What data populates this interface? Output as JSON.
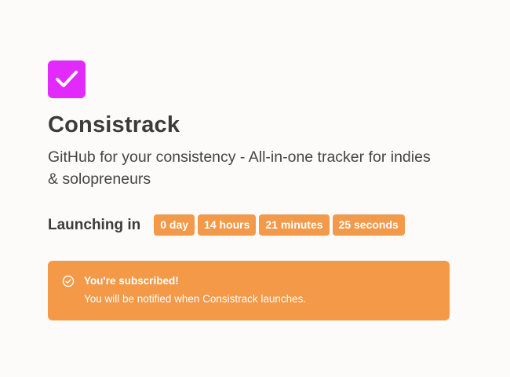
{
  "app": {
    "logo_icon": "checkbox-check-icon",
    "brand_color": "#e12afb",
    "name": "Consistrack",
    "tagline": "GitHub for your consistency - All-in-one tracker for indies & solopreneurs"
  },
  "countdown": {
    "label": "Launching in",
    "accent_color": "#f3994a",
    "units": [
      {
        "value": "0 day"
      },
      {
        "value": "14 hours"
      },
      {
        "value": "21 minutes"
      },
      {
        "value": "25 seconds"
      }
    ]
  },
  "alert": {
    "icon": "check-circle-icon",
    "title": "You're subscribed!",
    "message": "You will be notified when Consistrack launches."
  }
}
